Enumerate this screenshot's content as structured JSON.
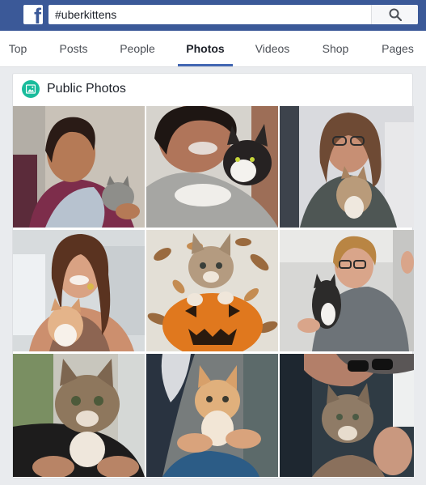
{
  "search": {
    "value": "#uberkittens"
  },
  "tabs": [
    {
      "label": "Top"
    },
    {
      "label": "Posts"
    },
    {
      "label": "People"
    },
    {
      "label": "Photos"
    },
    {
      "label": "Videos"
    },
    {
      "label": "Shop"
    },
    {
      "label": "Pages"
    }
  ],
  "active_tab": "Photos",
  "card": {
    "title": "Public Photos"
  },
  "colors": {
    "brand": "#3b5998",
    "tab_underline": "#4267b2",
    "card_icon": "#1abc9c"
  },
  "icons": [
    "facebook-logo-icon",
    "search-icon",
    "photo-icon"
  ]
}
